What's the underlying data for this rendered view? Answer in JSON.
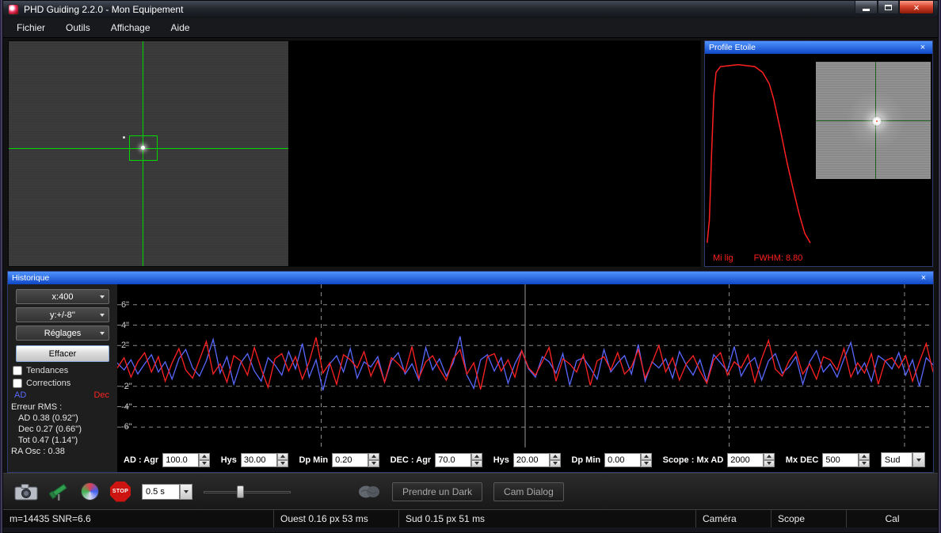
{
  "icons": {
    "close": "×"
  },
  "window": {
    "title": "PHD Guiding 2.2.0 - Mon Equipement"
  },
  "menu": {
    "items": [
      "Fichier",
      "Outils",
      "Affichage",
      "Aide"
    ]
  },
  "profile_panel": {
    "title": "Profile Etoile",
    "footer_left": "Mi lig",
    "fwhm": "FWHM: 8.80"
  },
  "history_panel": {
    "title": "Historique",
    "controls": {
      "x_scale": "x:400",
      "y_scale": "y:+/-8''",
      "reglages": "Réglages",
      "effacer": "Effacer",
      "tendances": "Tendances",
      "corrections": "Corrections",
      "ad_label": "AD",
      "dec_label": "Dec",
      "rms_title": "Erreur RMS :",
      "rms_ad": "AD  0.38 (0.92'')",
      "rms_dec": "Dec 0.27 (0.66'')",
      "rms_tot": "Tot  0.47 (1.14'')",
      "ra_osc": "RA Osc : 0.38"
    },
    "axis_labels": [
      "6\"",
      "4\"",
      "2\"",
      "-2\"",
      "-4\"",
      "-6\""
    ],
    "params": [
      {
        "label": "AD : Agr",
        "value": "100.0"
      },
      {
        "label": "Hys",
        "value": "30.00"
      },
      {
        "label": "Dp Min",
        "value": "0.20"
      },
      {
        "label": "DEC : Agr",
        "value": "70.0"
      },
      {
        "label": "Hys",
        "value": "20.00"
      },
      {
        "label": "Dp Min",
        "value": "0.00"
      },
      {
        "label": "Scope : Mx AD",
        "value": "2000"
      },
      {
        "label": "Mx DEC",
        "value": "500"
      }
    ],
    "direction_select": "Sud"
  },
  "toolbar": {
    "exposure": "0.5 s",
    "stop_label": "STOP",
    "dark_button": "Prendre un Dark",
    "cam_dialog_button": "Cam Dialog"
  },
  "status_bar": {
    "left": "m=14435 SNR=6.6",
    "west": "Ouest  0.16 px  53 ms",
    "south": "Sud 0.15 px 51 ms",
    "camera": "Caméra",
    "scope": "Scope",
    "cal": "Cal"
  },
  "chart_data": {
    "history": {
      "type": "line",
      "title": "Guiding history (arc-seconds)",
      "ylim": [
        -8,
        8
      ],
      "yticks": [
        6,
        4,
        2,
        -2,
        -4,
        -6
      ],
      "vgrid_percent": [
        25,
        50,
        75,
        96.5
      ],
      "grid": true,
      "legend_position": "side-panel",
      "series": [
        {
          "name": "AD",
          "color": "#5868ff",
          "values": [
            0.3,
            -0.4,
            0.6,
            -0.8,
            0.2,
            1.1,
            -0.6,
            0.4,
            -1.3,
            0.7,
            1.6,
            -0.2,
            -1.0,
            0.5,
            2.6,
            -0.7,
            0.9,
            -1.8,
            0.3,
            1.2,
            -0.5,
            -1.5,
            0.8,
            0.1,
            -0.9,
            1.4,
            -0.3,
            2.2,
            -1.1,
            0.6,
            -2.4,
            0.2,
            1.0,
            -0.6,
            1.7,
            -1.2,
            0.4,
            -0.1,
            0.9,
            -1.6,
            0.5,
            1.3,
            -0.8,
            0.2,
            -1.4,
            1.8,
            -0.4,
            0.7,
            -1.0,
            0.3,
            2.9,
            -0.9,
            -2.2,
            0.6,
            1.1,
            -0.5,
            0.8,
            -1.7,
            0.2,
            1.5,
            -0.3,
            -1.1,
            0.9,
            0.4,
            -0.7,
            1.2,
            -1.9,
            0.5,
            0.8,
            -0.2,
            -1.3,
            1.6,
            -0.6,
            0.3,
            1.0,
            -0.8,
            2.1,
            -1.5,
            0.4,
            -0.2,
            0.7,
            -1.2,
            1.4,
            0.1,
            -0.9,
            0.6,
            -1.6,
            1.1,
            0.3,
            -0.5,
            1.9,
            -1.0,
            0.2,
            0.8,
            -1.4,
            0.5,
            1.2,
            -0.7,
            -0.1,
            0.9,
            -1.8,
            0.4,
            1.5,
            -0.6,
            0.2,
            -1.1,
            0.7,
            2.3,
            -0.8,
            0.3,
            -1.5,
            1.0,
            0.5,
            -0.3,
            1.3,
            -0.9,
            0.6,
            -2.0,
            0.8,
            0.1
          ]
        },
        {
          "name": "Dec",
          "color": "#ff2222",
          "values": [
            -0.2,
            0.8,
            -1.1,
            0.4,
            1.3,
            -0.6,
            0.9,
            -1.5,
            0.3,
            1.7,
            -0.4,
            -1.2,
            0.6,
            2.4,
            -0.8,
            0.2,
            -1.6,
            1.0,
            0.5,
            -0.9,
            1.8,
            -0.3,
            -2.1,
            0.7,
            1.2,
            -0.5,
            0.9,
            -1.3,
            0.4,
            2.8,
            -0.7,
            0.3,
            -1.8,
            1.1,
            0.6,
            -0.2,
            1.4,
            -1.0,
            0.5,
            -1.6,
            0.8,
            0.2,
            -0.6,
            1.9,
            -1.2,
            0.4,
            1.0,
            -0.3,
            -1.4,
            0.7,
            1.6,
            -0.8,
            0.3,
            -2.3,
            0.9,
            1.2,
            -0.5,
            0.6,
            -1.1,
            1.5,
            -0.2,
            -0.9,
            0.4,
            1.8,
            -1.5,
            0.7,
            0.2,
            -0.6,
            1.1,
            -1.9,
            0.5,
            0.9,
            -0.4,
            1.3,
            -0.8,
            -0.1,
            1.6,
            -1.2,
            0.3,
            2.0,
            -0.6,
            0.8,
            -1.4,
            0.2,
            1.0,
            -0.5,
            -1.7,
            0.6,
            1.3,
            -0.9,
            0.4,
            -0.2,
            1.1,
            -1.6,
            0.7,
            2.5,
            -0.3,
            -1.0,
            0.5,
            1.4,
            -0.8,
            0.2,
            -1.3,
            0.9,
            0.6,
            -0.4,
            1.7,
            -1.1,
            0.3,
            -0.7,
            1.2,
            -1.8,
            0.5,
            0.8,
            -0.2,
            1.0,
            -1.5,
            0.4,
            2.2,
            -0.6
          ]
        }
      ]
    },
    "profile": {
      "type": "line",
      "name": "star-profile",
      "color": "#ff2020",
      "fwhm": "8.80",
      "points": [
        [
          2,
          97
        ],
        [
          4,
          85
        ],
        [
          6,
          50
        ],
        [
          8,
          20
        ],
        [
          10,
          8
        ],
        [
          14,
          5
        ],
        [
          30,
          4
        ],
        [
          45,
          5
        ],
        [
          52,
          8
        ],
        [
          58,
          14
        ],
        [
          62,
          22
        ],
        [
          68,
          38
        ],
        [
          74,
          55
        ],
        [
          80,
          70
        ],
        [
          85,
          82
        ],
        [
          90,
          92
        ],
        [
          95,
          97
        ]
      ]
    }
  }
}
